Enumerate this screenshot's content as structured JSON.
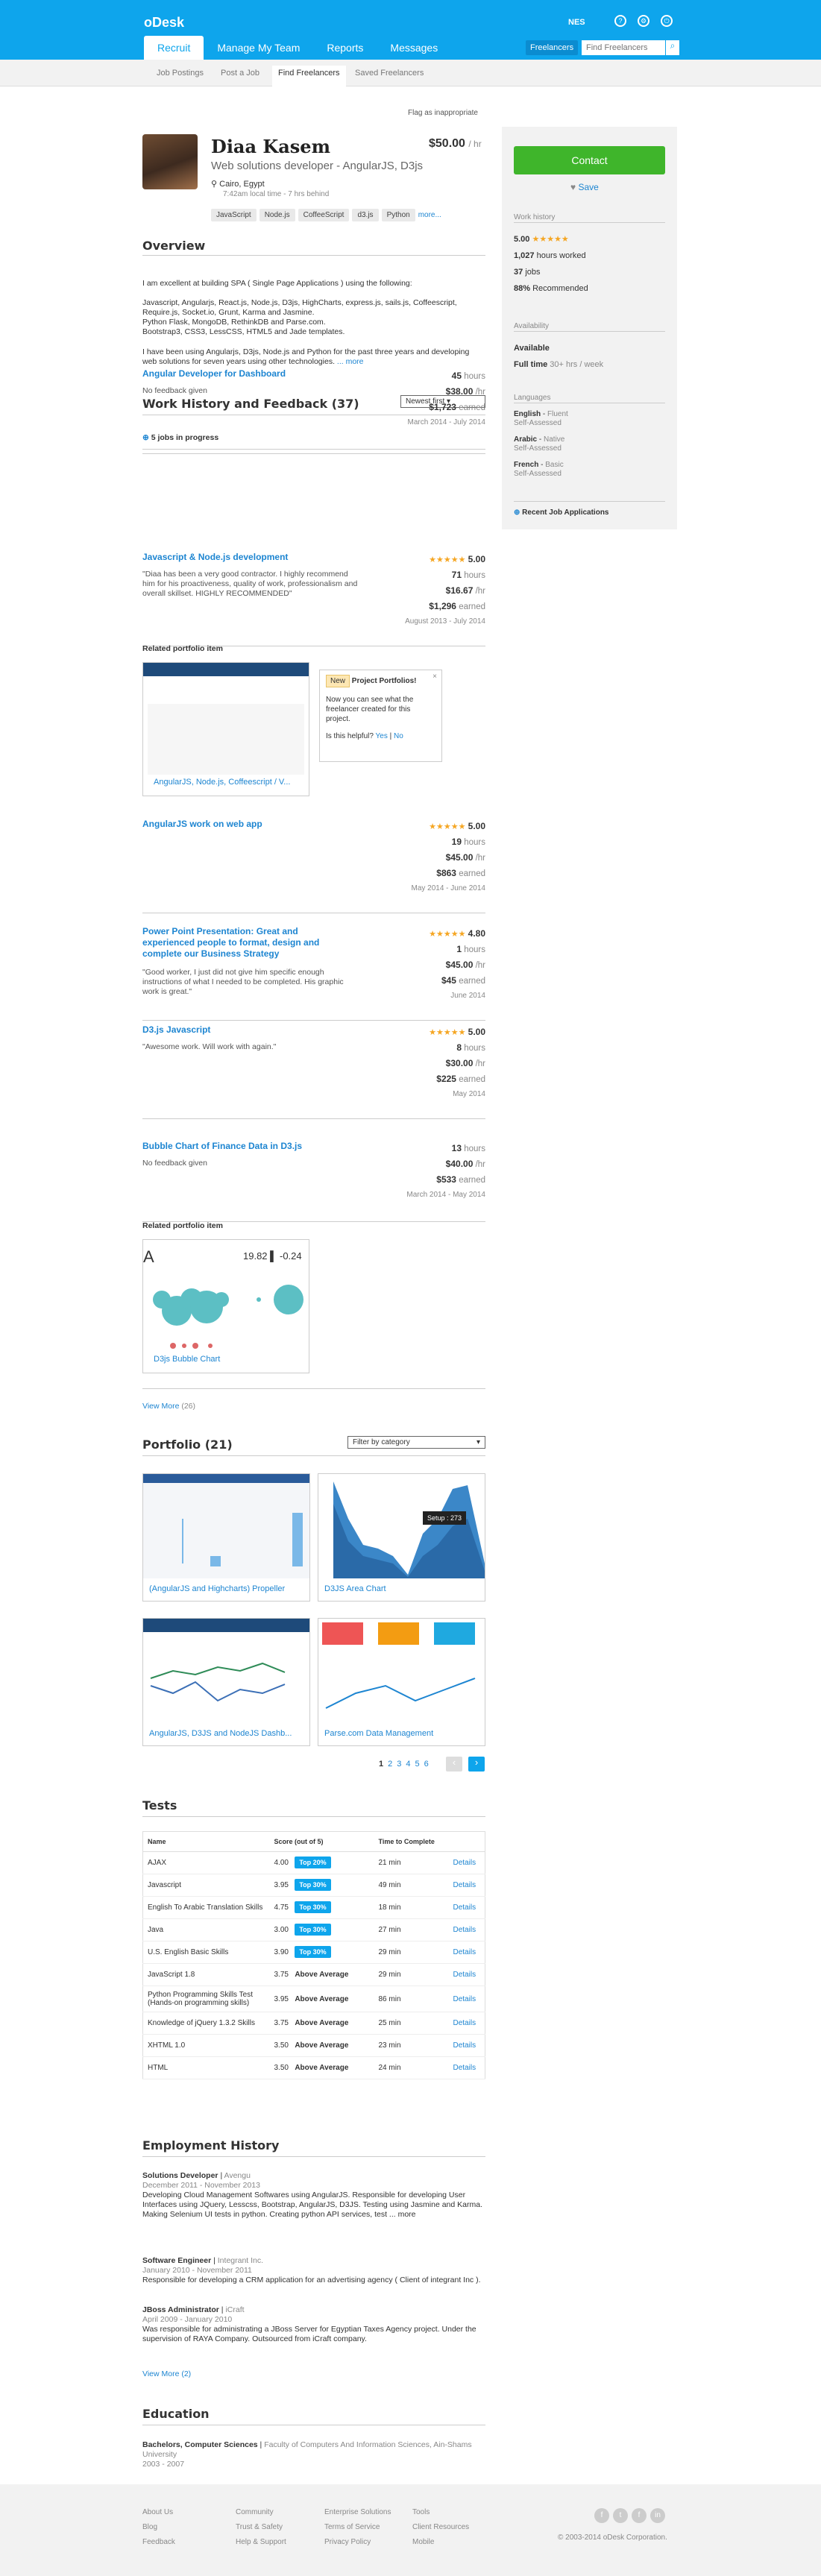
{
  "brand": "oDesk",
  "nav": [
    "Recruit",
    "Manage My Team",
    "Reports",
    "Messages"
  ],
  "user": "NES",
  "freelancers_label": "Freelancers",
  "search_placeholder": "Find Freelancers",
  "subnav": [
    "Job Postings",
    "Post a Job",
    "Find Freelancers",
    "Saved Freelancers"
  ],
  "flag": "Flag as inappropriate",
  "profile": {
    "name": "Diaa Kasem",
    "rate": "$50.00",
    "rate_unit": "/ hr",
    "title": "Web solutions developer - AngularJS, D3js",
    "location": "Cairo, Egypt",
    "local_time": "7:42am local time - 7 hrs behind",
    "skills": [
      "JavaScript",
      "Node.js",
      "CoffeeScript",
      "d3.js",
      "Python"
    ],
    "more": "more..."
  },
  "side": {
    "contact": "Contact",
    "save": "Save",
    "work_history": "Work history",
    "rating": "5.00",
    "hours": "1,027",
    "hours_label": "hours worked",
    "jobs": "37",
    "jobs_label": "jobs",
    "recommended": "88%",
    "recommended_label": "Recommended",
    "availability": "Availability",
    "available": "Available",
    "fulltime": "Full time",
    "fulltime_detail": "30+ hrs / week",
    "languages": "Languages",
    "langs": [
      {
        "name": "English",
        "level": "Fluent",
        "assess": "Self-Assessed"
      },
      {
        "name": "Arabic",
        "level": "Native",
        "assess": "Self-Assessed"
      },
      {
        "name": "French",
        "level": "Basic",
        "assess": "Self-Assessed"
      }
    ],
    "recent": "Recent Job Applications"
  },
  "overview": {
    "heading": "Overview",
    "p1": "I am excellent at building SPA ( Single Page Applications ) using the following:",
    "p2": "Javascript, Angularjs, React.js, Node.js, D3js, HighCharts, express.js, sails.js, Coffeescript, Require.js, Socket.io, Grunt, Karma and Jasmine.",
    "p3": "Python Flask, MongoDB, RethinkDB and Parse.com.",
    "p4": "Bootstrap3, CSS3, LessCSS, HTML5 and Jade templates.",
    "p5": "I have been using Angularjs, D3js, Node.js and Python for the past three years and developing web solutions for seven years using other technologies.",
    "more": "... more"
  },
  "work": {
    "heading": "Work History and Feedback (37)",
    "sort": "Newest first",
    "in_progress": "5 jobs in progress",
    "jobs": [
      {
        "title": "Angular Developer for Dashboard",
        "feedback": "No feedback given",
        "rating": "",
        "hours": "45",
        "rate": "$38.00",
        "earned": "$1,723",
        "dates": "March 2014 - July 2014"
      },
      {
        "title": "Javascript & Node.js development",
        "feedback": "\"Diaa has been a very good contractor. I highly recommend him for his proactiveness, quality of work, professionalism and overall skillset. HIGHLY RECOMMENDED\"",
        "rating": "5.00",
        "hours": "71",
        "rate": "$16.67",
        "earned": "$1,296",
        "dates": "August 2013 - July 2014"
      },
      {
        "title": "AngularJS work on web app",
        "feedback": "",
        "rating": "5.00",
        "hours": "19",
        "rate": "$45.00",
        "earned": "$863",
        "dates": "May 2014 - June 2014"
      },
      {
        "title": "Power Point Presentation: Great and experienced people to format, design and complete our Business Strategy",
        "feedback": "\"Good worker, I just did not give him specific enough instructions of what I needed to be completed. His graphic work is great.\"",
        "rating": "4.80",
        "hours": "1",
        "rate": "$45.00",
        "earned": "$45",
        "dates": "June 2014"
      },
      {
        "title": "D3.js Javascript",
        "feedback": "\"Awesome work. Will work with again.\"",
        "rating": "5.00",
        "hours": "8",
        "rate": "$30.00",
        "earned": "$225",
        "dates": "May 2014"
      },
      {
        "title": "Bubble Chart of Finance Data in D3.js",
        "feedback": "No feedback given",
        "rating": "",
        "hours": "13",
        "rate": "$40.00",
        "earned": "$533",
        "dates": "March 2014 - May 2014"
      }
    ],
    "related": "Related portfolio item",
    "related1": "AngularJS, Node.js, Coffeescript / V...",
    "popup_new": "New",
    "popup_title": "Project Portfolios!",
    "popup_body": "Now you can see what the freelancer created for this project.",
    "popup_q": "Is this helpful?",
    "popup_yes": "Yes",
    "popup_no": "No",
    "related2": "D3js Bubble Chart",
    "bubble_val1": "19.82",
    "bubble_val2": "-0.24",
    "view_more": "View More",
    "view_more_count": "(26)",
    "hours_suffix": "hours",
    "rate_suffix": "/hr",
    "earned_suffix": "earned"
  },
  "portfolio": {
    "heading": "Portfolio (21)",
    "filter": "Filter by category",
    "items": [
      "(AngularJS and Highcharts) Propeller",
      "D3JS Area Chart",
      "AngularJS, D3JS and NodeJS Dashb...",
      "Parse.com Data Management"
    ],
    "pages": [
      "1",
      "2",
      "3",
      "4",
      "5",
      "6"
    ],
    "tooltip": "Setup : 273"
  },
  "tests": {
    "heading": "Tests",
    "cols": [
      "Name",
      "Score (out of 5)",
      "Time to Complete"
    ],
    "rows": [
      [
        "AJAX",
        "4.00",
        "Top 20%",
        "21 min"
      ],
      [
        "Javascript",
        "3.95",
        "Top 30%",
        "49 min"
      ],
      [
        "English To Arabic Translation Skills",
        "4.75",
        "Top 30%",
        "18 min"
      ],
      [
        "Java",
        "3.00",
        "Top 30%",
        "27 min"
      ],
      [
        "U.S. English Basic Skills",
        "3.90",
        "Top 30%",
        "29 min"
      ],
      [
        "JavaScript 1.8",
        "3.75",
        "Above Average",
        "29 min"
      ],
      [
        "Python Programming Skills Test (Hands-on programming skills)",
        "3.95",
        "Above Average",
        "86 min"
      ],
      [
        "Knowledge of jQuery 1.3.2 Skills",
        "3.75",
        "Above Average",
        "25 min"
      ],
      [
        "XHTML 1.0",
        "3.50",
        "Above Average",
        "23 min"
      ],
      [
        "HTML",
        "3.50",
        "Above Average",
        "24 min"
      ]
    ],
    "details": "Details"
  },
  "employment": {
    "heading": "Employment History",
    "items": [
      {
        "role": "Solutions Developer",
        "company": "Avengu",
        "dates": "December 2011 - November 2013",
        "desc": "Developing Cloud Management Softwares using AngularJS. Responsible for developing User Interfaces using JQuery, Lesscss, Bootstrap, AngularJS, D3JS. Testing using Jasmine and Karma. Making Selenium UI tests in python. Creating python API services, test ... more"
      },
      {
        "role": "Software Engineer",
        "company": "Integrant Inc.",
        "dates": "January 2010 - November 2011",
        "desc": "Responsible for developing a CRM application for an advertising agency ( Client of integrant Inc )."
      },
      {
        "role": "JBoss Administrator",
        "company": "iCraft",
        "dates": "April 2009 - January 2010",
        "desc": "Was responsible for administrating a JBoss Server for Egyptian Taxes Agency project. Under the supervision of RAYA Company. Outsourced from iCraft company."
      }
    ],
    "view_more": "View More (2)"
  },
  "education": {
    "heading": "Education",
    "degree": "Bachelors, Computer Sciences",
    "school": "Faculty of Computers And Information Sciences, Ain-Shams University",
    "dates": "2003 - 2007"
  },
  "footer": {
    "c1": [
      "About Us",
      "Blog",
      "Feedback"
    ],
    "c2": [
      "Community",
      "Trust & Safety",
      "Help & Support"
    ],
    "c3": [
      "Enterprise Solutions",
      "Terms of Service",
      "Privacy Policy"
    ],
    "c4": [
      "Tools",
      "Client Resources",
      "Mobile"
    ],
    "copy": "© 2003-2014 oDesk Corporation."
  }
}
